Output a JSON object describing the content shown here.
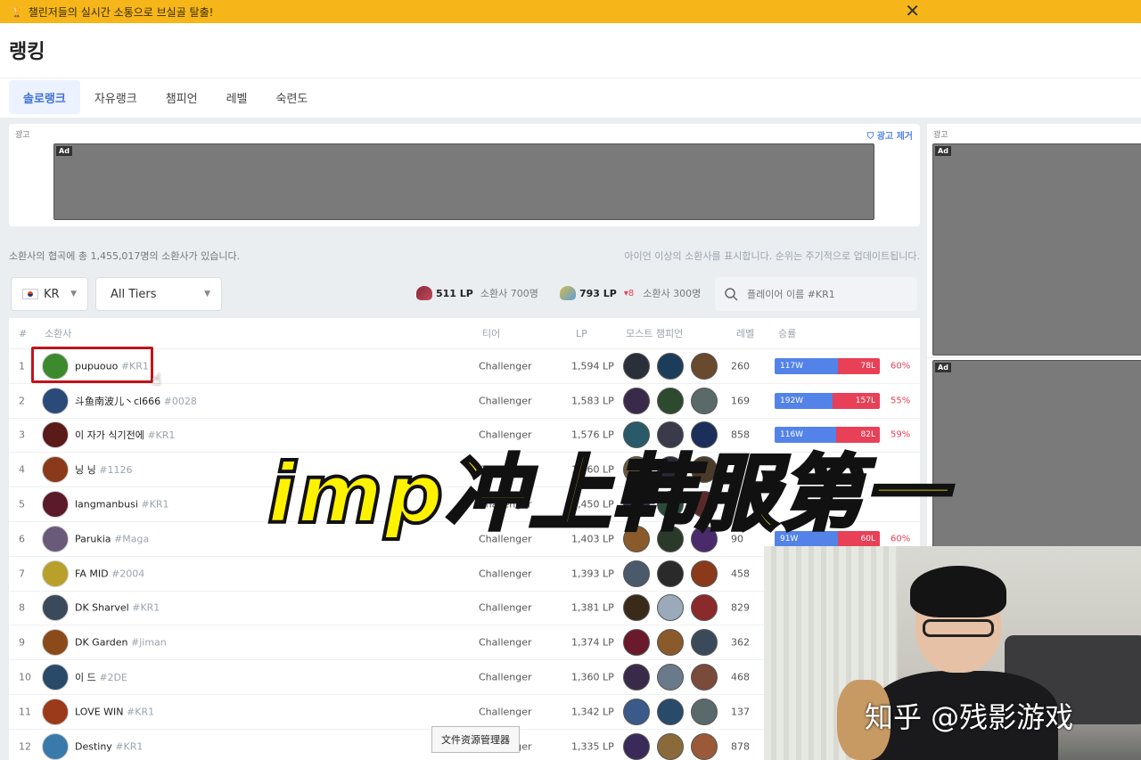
{
  "banner": {
    "text": "챌린저들의 실시간 소통으로 브실골 탈출!",
    "close": "✕"
  },
  "page_title": "랭킹",
  "tabs": [
    "솔로랭크",
    "자유랭크",
    "챔피언",
    "레벨",
    "숙련도"
  ],
  "ad": {
    "label": "광고",
    "remove": "광고 제거",
    "tag": "Ad"
  },
  "info": {
    "left": "소환사의 협곡에 총 1,455,017명의 소환사가 있습니다.",
    "right": "아이언 이상의 소환사를 표시합니다. 순위는 주기적으로 업데이트됩니다."
  },
  "filters": {
    "region": "KR",
    "tier": "All Tiers"
  },
  "cutoffs": {
    "grandmaster_lp": "511 LP",
    "grandmaster_count": "소환사 700명",
    "challenger_lp": "793 LP",
    "challenger_drop": "▾8",
    "challenger_count": "소환사 300명"
  },
  "search": {
    "placeholder": "플레이어 이름 #KR1"
  },
  "columns": {
    "rank": "#",
    "summoner": "소환사",
    "tier": "티어",
    "lp": "LP",
    "champs": "모스트 챔피언",
    "level": "레벨",
    "winrate": "승률"
  },
  "rows": [
    {
      "rank": "1",
      "name": "pupuouo",
      "tag": "#KR1",
      "tier": "Challenger",
      "lp": "1,594 LP",
      "level": "260",
      "wins": "117W",
      "losses": "78L",
      "wins_n": 117,
      "losses_n": 78,
      "pct": "60%",
      "ava": "#3d8a2e",
      "c1": "#2b2f3a",
      "c2": "#1c3d5a",
      "c3": "#6a4a2e"
    },
    {
      "rank": "2",
      "name": "斗鱼南波儿丶cl666",
      "tag": "#0028",
      "tier": "Challenger",
      "lp": "1,583 LP",
      "level": "169",
      "wins": "192W",
      "losses": "157L",
      "wins_n": 192,
      "losses_n": 157,
      "pct": "55%",
      "ava": "#2c4a78",
      "c1": "#3a2a4a",
      "c2": "#2e4a2e",
      "c3": "#5a6a6a"
    },
    {
      "rank": "3",
      "name": "이 자가 식기전에",
      "tag": "#KR1",
      "tier": "Challenger",
      "lp": "1,576 LP",
      "level": "858",
      "wins": "116W",
      "losses": "82L",
      "wins_n": 116,
      "losses_n": 82,
      "pct": "59%",
      "ava": "#5a1a1a",
      "c1": "#2a5a6a",
      "c2": "#3a3a4a",
      "c3": "#1c2e5a"
    },
    {
      "rank": "4",
      "name": "닝 닝",
      "tag": "#1126",
      "tier": "Challenger",
      "lp": "1,560 LP",
      "level": "",
      "wins": "",
      "losses": "",
      "wins_n": 0,
      "losses_n": 0,
      "pct": "",
      "ava": "#8a3a1a",
      "c1": "#6a5a3a",
      "c2": "#2a2a3a",
      "c3": "#4a3a2a"
    },
    {
      "rank": "5",
      "name": "langmanbusi",
      "tag": "#KR1",
      "tier": "Challenger",
      "lp": "1,450 LP",
      "level": "",
      "wins": "",
      "losses": "",
      "wins_n": 0,
      "losses_n": 0,
      "pct": "",
      "ava": "#5a1a2a",
      "c1": "#3a3a5a",
      "c2": "#2a4a3a",
      "c3": "#5a2a2a"
    },
    {
      "rank": "6",
      "name": "Parukia",
      "tag": "#Maga",
      "tier": "Challenger",
      "lp": "1,403 LP",
      "level": "90",
      "wins": "91W",
      "losses": "60L",
      "wins_n": 91,
      "losses_n": 60,
      "pct": "60%",
      "ava": "#6a5a7a",
      "c1": "#8a5a2a",
      "c2": "#2a3a2a",
      "c3": "#4a2a6a"
    },
    {
      "rank": "7",
      "name": "FA MID",
      "tag": "#2004",
      "tier": "Challenger",
      "lp": "1,393 LP",
      "level": "458",
      "wins": "",
      "losses": "",
      "wins_n": 0,
      "losses_n": 0,
      "pct": "",
      "ava": "#b8a02a",
      "c1": "#4a5a6a",
      "c2": "#2a2a2a",
      "c3": "#8a3a1a"
    },
    {
      "rank": "8",
      "name": "DK Sharvel",
      "tag": "#KR1",
      "tier": "Challenger",
      "lp": "1,381 LP",
      "level": "829",
      "wins": "",
      "losses": "",
      "wins_n": 0,
      "losses_n": 0,
      "pct": "",
      "ava": "#3a4a5a",
      "c1": "#3a2a1a",
      "c2": "#9aaabb",
      "c3": "#8a2a2a"
    },
    {
      "rank": "9",
      "name": "DK Garden",
      "tag": "#jiman",
      "tier": "Challenger",
      "lp": "1,374 LP",
      "level": "362",
      "wins": "",
      "losses": "",
      "wins_n": 0,
      "losses_n": 0,
      "pct": "",
      "ava": "#8a4a1a",
      "c1": "#6a1a2a",
      "c2": "#8a5a2a",
      "c3": "#3a4a5a"
    },
    {
      "rank": "10",
      "name": "이 드",
      "tag": "#2DE",
      "tier": "Challenger",
      "lp": "1,360 LP",
      "level": "468",
      "wins": "",
      "losses": "",
      "wins_n": 0,
      "losses_n": 0,
      "pct": "",
      "ava": "#2a4a6a",
      "c1": "#3a2a4a",
      "c2": "#6a7a8a",
      "c3": "#7a4a3a"
    },
    {
      "rank": "11",
      "name": "LOVE WIN",
      "tag": "#KR1",
      "tier": "Challenger",
      "lp": "1,342 LP",
      "level": "137",
      "wins": "",
      "losses": "",
      "wins_n": 0,
      "losses_n": 0,
      "pct": "",
      "ava": "#9a3a1a",
      "c1": "#3a5a8a",
      "c2": "#2a4a6a",
      "c3": "#5a6a6a"
    },
    {
      "rank": "12",
      "name": "Destiny",
      "tag": "#KR1",
      "tier": "Challenger",
      "lp": "1,335 LP",
      "level": "878",
      "wins": "",
      "losses": "",
      "wins_n": 0,
      "losses_n": 0,
      "pct": "",
      "ava": "#3a7aaa",
      "c1": "#3a2a5a",
      "c2": "#8a6a3a",
      "c3": "#9a5a3a"
    }
  ],
  "overlay_text": "imp冲上韩服第一",
  "watermark": "知乎 @残影游戏",
  "tooltip": "文件资源管理器"
}
